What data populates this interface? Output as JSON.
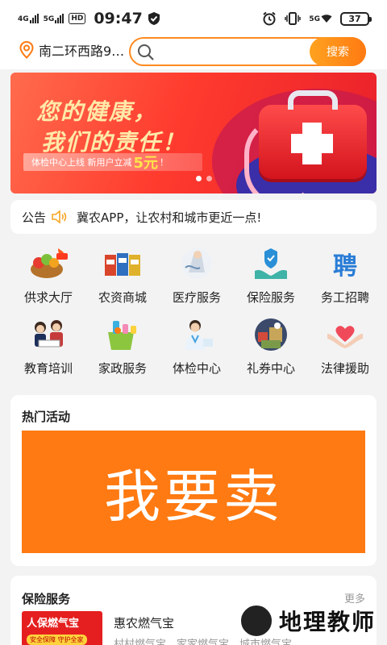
{
  "status": {
    "network1": "4G",
    "network2": "5G",
    "hd": "HD",
    "time": "09:47",
    "net_right": "5G",
    "battery": "37"
  },
  "header": {
    "location": "南二环西路9…",
    "search_placeholder": "",
    "search_button": "搜索",
    "accent": "#ff8a1f"
  },
  "banner": {
    "line1": "您的健康，",
    "line2": "我们的责任！",
    "promo_prefix": "体检中心上线 新用户立减",
    "promo_amount": "5元",
    "promo_suffix": "！",
    "dots": 2,
    "active_dot": 0
  },
  "notice": {
    "label": "公告",
    "text": "冀农APP，让农村和城市更近一点!"
  },
  "categories": [
    {
      "label": "供求大厅",
      "icon": "produce-basket-icon"
    },
    {
      "label": "农资商城",
      "icon": "fertilizer-bags-icon"
    },
    {
      "label": "医疗服务",
      "icon": "medical-service-icon"
    },
    {
      "label": "保险服务",
      "icon": "insurance-hands-icon"
    },
    {
      "label": "务工招聘",
      "icon": "recruit-icon"
    },
    {
      "label": "教育培训",
      "icon": "education-kids-icon"
    },
    {
      "label": "家政服务",
      "icon": "cleaning-bucket-icon"
    },
    {
      "label": "体检中心",
      "icon": "nurse-icon"
    },
    {
      "label": "礼券中心",
      "icon": "gift-coupon-icon"
    },
    {
      "label": "法律援助",
      "icon": "heart-hands-icon"
    }
  ],
  "hot": {
    "title": "热门活动",
    "cta": "我要卖"
  },
  "insurance": {
    "title": "保险服务",
    "more": "更多",
    "thumb_title": "人保燃气宝",
    "thumb_tag": "安全保障 守护全家",
    "item_name": "惠农燃气宝",
    "item_desc": "村村燃气宝，家家燃气宝，城市燃气宝"
  },
  "watermark": {
    "text": "地理教师"
  },
  "recruit_glyph": "聘"
}
